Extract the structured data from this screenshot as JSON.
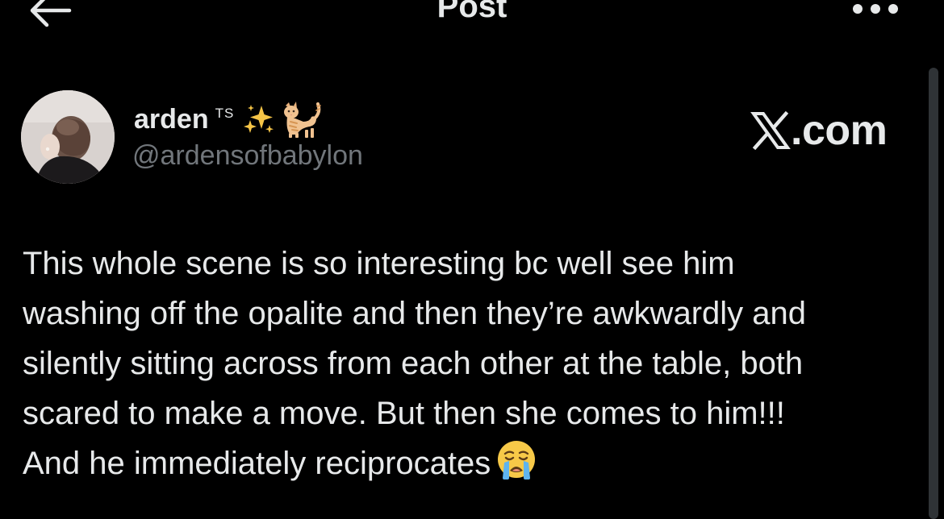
{
  "header": {
    "title": "Post",
    "back_icon": "arrow-left-icon",
    "more_icon": "more-horizontal-icon"
  },
  "author": {
    "display_name": "arden",
    "name_suffix": "TS",
    "name_emojis": [
      "sparkles-icon",
      "cat-icon"
    ],
    "username": "@ardensofbabylon"
  },
  "watermark": {
    "text": ".com",
    "icon": "x-logo-icon"
  },
  "post": {
    "lines": [
      "This whole scene is so interesting bc well see him",
      "washing off the opalite and then they’re awkwardly and",
      "silently sitting across from each other at the table, both",
      "scared to make a move. But then she comes to him!!!",
      "And he immediately reciprocates"
    ],
    "trailing_emoji": "crying-face-icon"
  },
  "colors": {
    "background": "#000000",
    "text_primary": "#e7e9ea",
    "text_secondary": "#71767b"
  }
}
